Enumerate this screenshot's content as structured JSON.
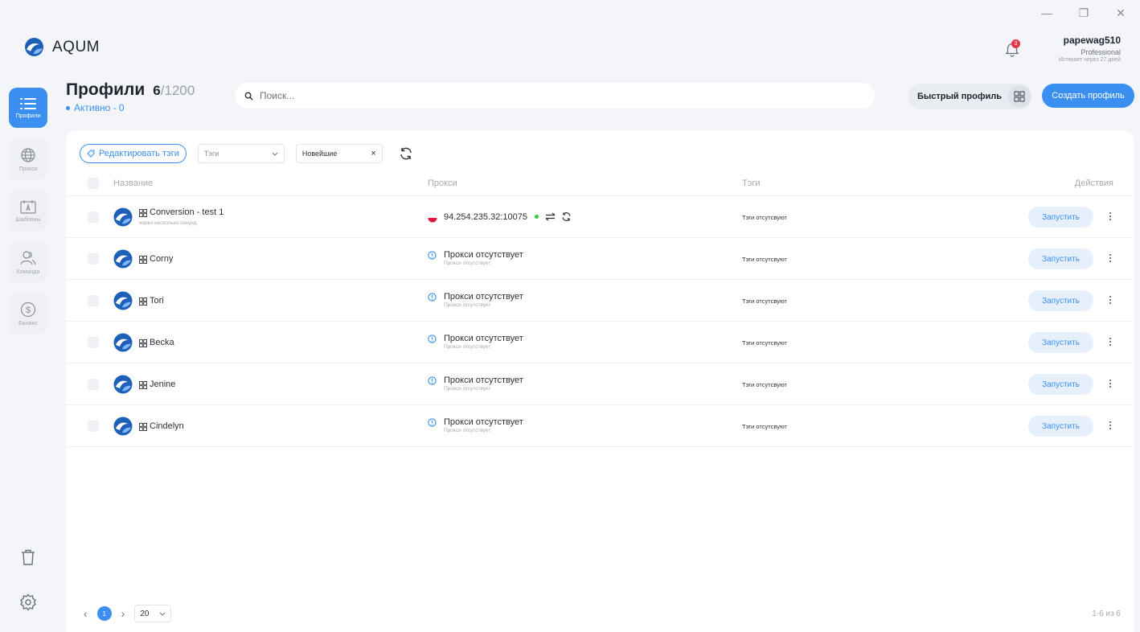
{
  "window": {
    "minimize": "—",
    "restore": "❐",
    "close": "✕"
  },
  "app": {
    "name": "AQUM"
  },
  "user": {
    "name": "papewag510",
    "plan": "Professional",
    "expires": "Истекает через 27 дней",
    "notifications": "3"
  },
  "sidebar": {
    "items": [
      {
        "label": "Профили",
        "icon": "list-icon",
        "active": true
      },
      {
        "label": "Прокси",
        "icon": "globe-icon",
        "active": false
      },
      {
        "label": "Шаблоны",
        "icon": "template-icon",
        "active": false
      },
      {
        "label": "Команда",
        "icon": "team-icon",
        "active": false
      },
      {
        "label": "Баланс",
        "icon": "dollar-icon",
        "active": false
      }
    ]
  },
  "header": {
    "title": "Профили",
    "count": "6",
    "count_max": "/1200",
    "active": "Активно - 0"
  },
  "search": {
    "placeholder": "Поиск..."
  },
  "actions": {
    "quick_profile": "Быстрый профиль",
    "create_profile": "Создать профиль"
  },
  "toolbar": {
    "edit_tags": "Редактировать тэги",
    "tags_filter": "Тэги",
    "sort": "Новейшие",
    "sort_clear": "×"
  },
  "table": {
    "columns": {
      "name": "Название",
      "proxy": "Прокси",
      "tags": "Тэги",
      "actions": "Действия"
    },
    "rows": [
      {
        "name": "Conversion - test 1",
        "subtitle": "через несколько секунд",
        "proxy": "94.254.235.32:10075",
        "proxy_sub": "",
        "has_proxy": true,
        "tags": "Тэги отсутсвуют",
        "run": "Запустить"
      },
      {
        "name": "Corny",
        "subtitle": "",
        "proxy": "Прокси отсутствует",
        "proxy_sub": "Прокси отсутствует",
        "has_proxy": false,
        "tags": "Тэги отсутсвуют",
        "run": "Запустить"
      },
      {
        "name": "Tori",
        "subtitle": "",
        "proxy": "Прокси отсутствует",
        "proxy_sub": "Прокси отсутствует",
        "has_proxy": false,
        "tags": "Тэги отсутсвуют",
        "run": "Запустить"
      },
      {
        "name": "Becka",
        "subtitle": "",
        "proxy": "Прокси отсутствует",
        "proxy_sub": "Прокси отсутствует",
        "has_proxy": false,
        "tags": "Тэги отсутсвуют",
        "run": "Запустить"
      },
      {
        "name": "Jenine",
        "subtitle": "",
        "proxy": "Прокси отсутствует",
        "proxy_sub": "Прокси отсутствует",
        "has_proxy": false,
        "tags": "Тэги отсутсвуют",
        "run": "Запустить"
      },
      {
        "name": "Cindelyn",
        "subtitle": "",
        "proxy": "Прокси отсутствует",
        "proxy_sub": "Прокси отсутствует",
        "has_proxy": false,
        "tags": "Тэги отсутсвуют",
        "run": "Запустить"
      }
    ]
  },
  "pagination": {
    "prev": "‹",
    "current": "1",
    "next": "›",
    "page_size": "20",
    "total": "1-6 из 6"
  },
  "colors": {
    "accent": "#3b8ff0",
    "badge": "#e5384e",
    "status_online": "#2ecc40"
  }
}
